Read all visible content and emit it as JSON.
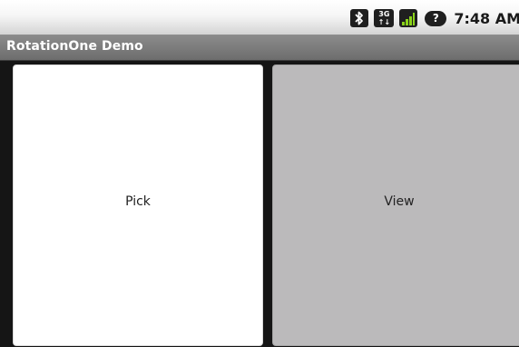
{
  "status_bar": {
    "network_type": "3G",
    "battery_badge": "?",
    "time": "7:48 AM",
    "icons": [
      "bluetooth-icon",
      "network-3g-icon",
      "signal-strength-icon",
      "battery-icon"
    ],
    "signal_color": "#8ad21a"
  },
  "title_bar": {
    "title": "RotationOne Demo"
  },
  "buttons": {
    "pick_label": "Pick",
    "view_label": "View"
  },
  "colors": {
    "title_bar": "#7a7a7a",
    "pick_background": "#ffffff",
    "view_background": "#bbbabb",
    "content_background": "#151515"
  }
}
